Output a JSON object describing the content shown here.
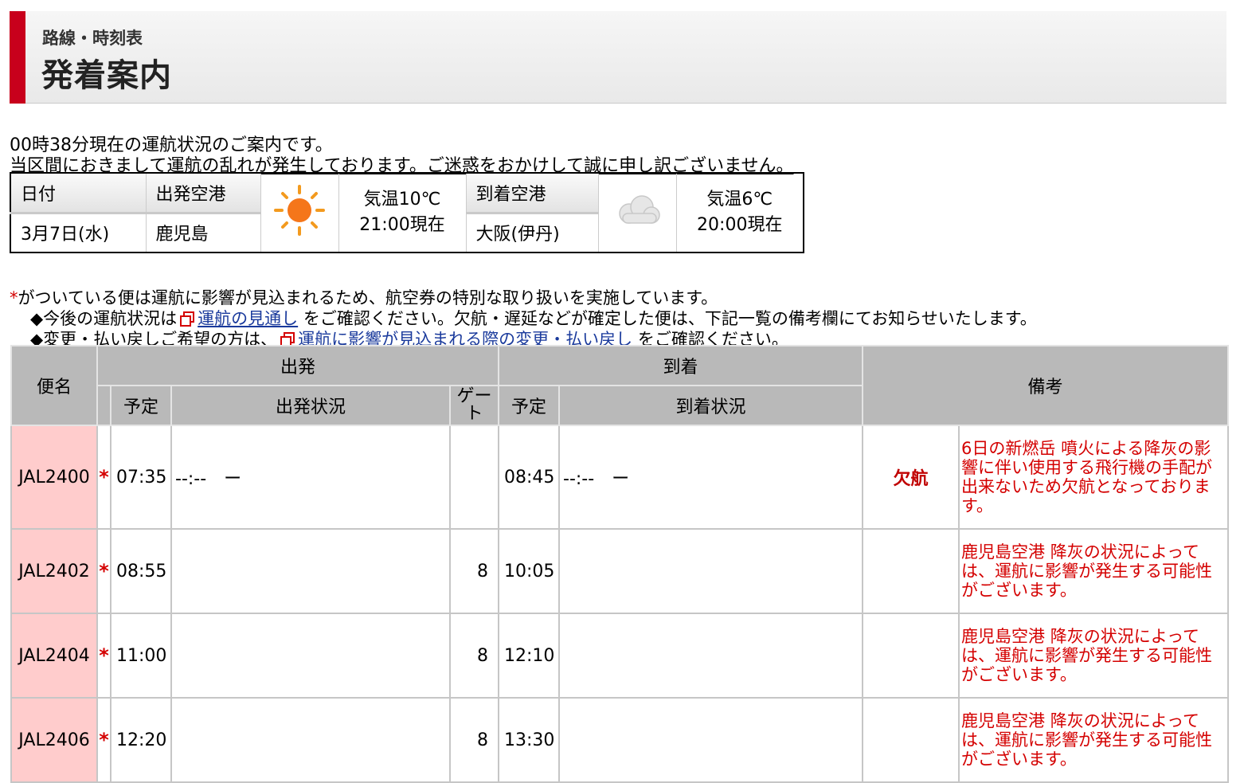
{
  "header": {
    "subtitle": "路線・時刻表",
    "title": "発着案内"
  },
  "status_line": "00時38分現在の運航状況のご案内です。",
  "disruption_line": "当区間におきまして運航の乱れが発生しております。ご迷惑をおかけして誠に申し訳ございません。",
  "info": {
    "date_label": "日付",
    "date_value": "3月7日(水)",
    "dep_label": "出発空港",
    "dep_value": "鹿児島",
    "dep_weather_icon": "sun-icon",
    "dep_temp": "気温10℃",
    "dep_time": "21:00現在",
    "arr_label": "到着空港",
    "arr_value": "大阪(伊丹)",
    "arr_weather_icon": "cloud-icon",
    "arr_temp": "気温6℃",
    "arr_time": "20:00現在"
  },
  "notice": {
    "asterisk": "*",
    "main": "がついている便は運航に影響が見込まれるため、航空券の特別な取り扱いを実施しています。",
    "b1_pre": "◆今後の運航状況は",
    "b1_link": "運航の見通し",
    "b1_post": "をご確認ください。欠航・遅延などが確定した便は、下記一覧の備考欄にてお知らせいたします。",
    "b2_pre": "◆変更・払い戻しご希望の方は、",
    "b2_link": "運航に影響が見込まれる際の変更・払い戻し",
    "b2_post": "をご確認ください。"
  },
  "table_headers": {
    "flight": "便名",
    "departure": "出発",
    "arrival": "到着",
    "remarks": "備考",
    "dep_sched": "予定",
    "dep_status": "出発状況",
    "gate": "ゲート",
    "arr_sched": "予定",
    "arr_status": "到着状況"
  },
  "flights": [
    {
      "flight": "JAL2400",
      "mark": "*",
      "dep": "07:35",
      "dep_status": "--:--　ー",
      "gate": "",
      "arr": "08:45",
      "arr_status": "--:--　ー",
      "status": "欠航",
      "remark": "6日の新燃岳 噴火による降灰の影響に伴い使用する飛行機の手配が出来ないため欠航となっております。"
    },
    {
      "flight": "JAL2402",
      "mark": "*",
      "dep": "08:55",
      "dep_status": "",
      "gate": "8",
      "arr": "10:05",
      "arr_status": "",
      "status": "",
      "remark": "鹿児島空港 降灰の状況によっては、運航に影響が発生する可能性がございます。"
    },
    {
      "flight": "JAL2404",
      "mark": "*",
      "dep": "11:00",
      "dep_status": "",
      "gate": "8",
      "arr": "12:10",
      "arr_status": "",
      "status": "",
      "remark": "鹿児島空港 降灰の状況によっては、運航に影響が発生する可能性がございます。"
    },
    {
      "flight": "JAL2406",
      "mark": "*",
      "dep": "12:20",
      "dep_status": "",
      "gate": "8",
      "arr": "13:30",
      "arr_status": "",
      "status": "",
      "remark": "鹿児島空港 降灰の状況によっては、運航に影響が発生する可能性がございます。"
    }
  ]
}
